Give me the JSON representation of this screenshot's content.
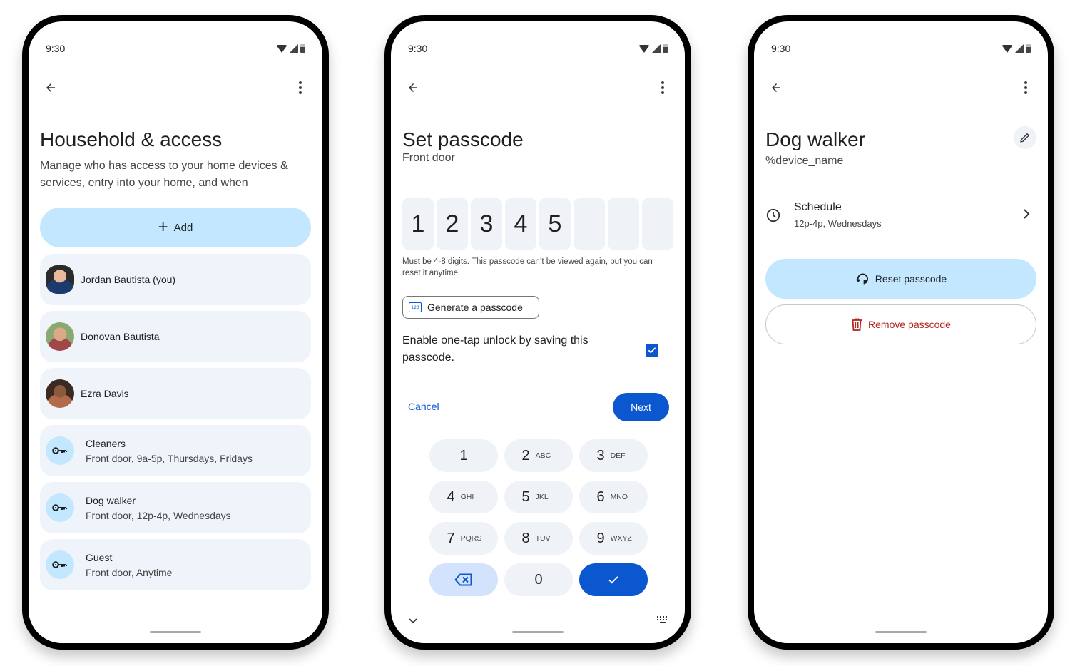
{
  "screens": {
    "household": {
      "status_time": "9:30",
      "title": "Household & access",
      "subtitle": "Manage who has access to your home devices & services, entry into your home, and when",
      "add_label": "Add",
      "members": [
        {
          "name": "Jordan Bautista (you)"
        },
        {
          "name": "Donovan Bautista"
        },
        {
          "name": "Ezra Davis"
        }
      ],
      "access_entries": [
        {
          "title": "Cleaners",
          "detail": "Front door, 9a-5p, Thursdays, Fridays",
          "icon": "key-icon"
        },
        {
          "title": "Dog walker",
          "detail": "Front door, 12p-4p, Wednesdays",
          "icon": "key-icon"
        },
        {
          "title": "Guest",
          "detail": "Front door, Anytime",
          "icon": "key-icon"
        }
      ]
    },
    "set_passcode": {
      "status_time": "9:30",
      "title": "Set passcode",
      "subtitle": "Front door",
      "digits": [
        "1",
        "2",
        "3",
        "4",
        "5",
        "",
        "",
        ""
      ],
      "hint": "Must be 4-8 digits. This passcode can’t be viewed again, but you can reset it anytime.",
      "generate_label": "Generate a passcode",
      "generate_icon_text": "123",
      "one_tap_label": "Enable one-tap unlock by saving this passcode.",
      "one_tap_checked": true,
      "cancel_label": "Cancel",
      "next_label": "Next",
      "keypad": [
        {
          "num": "1",
          "letters": ""
        },
        {
          "num": "2",
          "letters": "ABC"
        },
        {
          "num": "3",
          "letters": "DEF"
        },
        {
          "num": "4",
          "letters": "GHI"
        },
        {
          "num": "5",
          "letters": "JKL"
        },
        {
          "num": "6",
          "letters": "MNO"
        },
        {
          "num": "7",
          "letters": "PQRS"
        },
        {
          "num": "8",
          "letters": "TUV"
        },
        {
          "num": "9",
          "letters": "WXYZ"
        },
        {
          "num": "0",
          "letters": ""
        }
      ]
    },
    "dog_walker": {
      "status_time": "9:30",
      "title": "Dog walker",
      "subtitle": "%device_name",
      "schedule_label": "Schedule",
      "schedule_value": "12p-4p, Wednesdays",
      "reset_label": "Reset passcode",
      "remove_label": "Remove passcode"
    }
  },
  "colors": {
    "primary": "#0b57d0",
    "tonal": "#c2e7ff",
    "surface": "#eff4fb",
    "danger": "#b3261e"
  }
}
